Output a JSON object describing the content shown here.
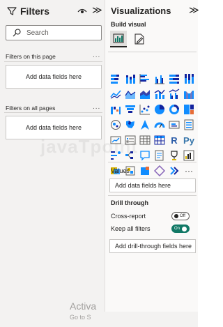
{
  "filters": {
    "title": "Filters",
    "search_placeholder": "Search",
    "sections": [
      {
        "label": "Filters on this page",
        "drop_text": "Add data fields here"
      },
      {
        "label": "Filters on all pages",
        "drop_text": "Add data fields here"
      }
    ],
    "more_label": "..."
  },
  "visualizations": {
    "title": "Visualizations",
    "build_visual": "Build visual",
    "tabs": [
      "build-visual-icon",
      "format-visual-icon"
    ],
    "icons": [
      "stacked-bar-chart-icon",
      "stacked-column-chart-icon",
      "clustered-bar-chart-icon",
      "clustered-column-chart-icon",
      "100-stacked-bar-chart-icon",
      "100-stacked-column-chart-icon",
      "line-chart-icon",
      "area-chart-icon",
      "stacked-area-chart-icon",
      "line-and-stacked-column-icon",
      "line-and-clustered-column-icon",
      "ribbon-chart-icon",
      "waterfall-chart-icon",
      "funnel-chart-icon",
      "scatter-chart-icon",
      "pie-chart-icon",
      "donut-chart-icon",
      "treemap-icon",
      "map-icon",
      "filled-map-icon",
      "azure-map-icon",
      "gauge-icon",
      "card-icon",
      "multi-row-card-icon",
      "kpi-icon",
      "slicer-icon",
      "table-icon",
      "matrix-icon",
      "r-visual-icon",
      "python-visual-icon",
      "key-influencers-icon",
      "decomposition-tree-icon",
      "qa-icon",
      "smart-narrative-icon",
      "paginated-report-icon",
      "metrics-icon",
      "power-apps-icon",
      "power-automate-icon",
      "shape-icon",
      "arcgis-icon",
      "chevron-icon",
      "more-visuals-icon"
    ],
    "r_text": "R",
    "py_text": "Py",
    "values_label": "Values",
    "values_drop": "Add data fields here",
    "drill_title": "Drill through",
    "cross_report_label": "Cross-report",
    "cross_report_state": "Off",
    "keep_filters_label": "Keep all filters",
    "keep_filters_state": "On",
    "drill_drop": "Add drill-through fields here",
    "more_label": "···"
  },
  "watermark": "javaTpoint",
  "activate": {
    "title": "Activa",
    "subtitle": "Go to S"
  },
  "colors": {
    "accent": "#117865",
    "chart_blue": "#118dff",
    "chart_navy": "#12239e",
    "chart_orange": "#e66c37",
    "chart_yellow": "#d9b300"
  }
}
